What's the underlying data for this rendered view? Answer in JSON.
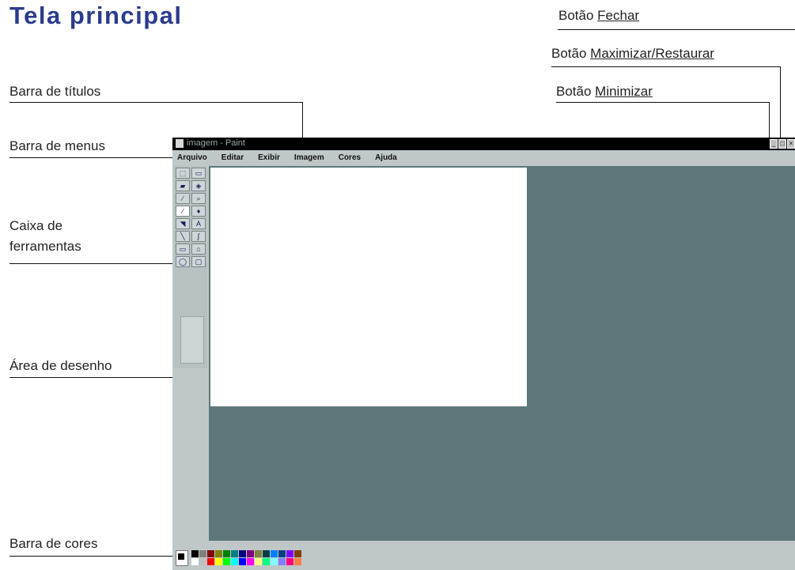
{
  "heading": "Tela principal",
  "callouts": {
    "fechar": {
      "prefix": "Botão ",
      "link": "Fechar"
    },
    "maximizar": {
      "prefix": "Botão ",
      "link": "Maximizar/Restaurar"
    },
    "minimizar": {
      "prefix": "Botão ",
      "link": "Minimizar"
    },
    "titulos": "Barra de títulos",
    "menus": "Barra de menus",
    "ferramentas": "Caixa de ferramentas",
    "desenho": "Área de desenho",
    "cores": "Barra de cores"
  },
  "window": {
    "title": "imagem - Paint",
    "menu": [
      "Arquivo",
      "Editar",
      "Exibir",
      "Imagem",
      "Cores",
      "Ajuda"
    ]
  },
  "tools": [
    {
      "icon": "free-select-icon",
      "glyph": "⬚"
    },
    {
      "icon": "rect-select-icon",
      "glyph": "▭"
    },
    {
      "icon": "eraser-icon",
      "glyph": "▰"
    },
    {
      "icon": "fill-icon",
      "glyph": "◈"
    },
    {
      "icon": "pick-color-icon",
      "glyph": "∕"
    },
    {
      "icon": "magnifier-icon",
      "glyph": "⌕"
    },
    {
      "icon": "pencil-icon",
      "glyph": "∕"
    },
    {
      "icon": "brush-icon",
      "glyph": "♦"
    },
    {
      "icon": "airbrush-icon",
      "glyph": "◥"
    },
    {
      "icon": "text-icon",
      "glyph": "A"
    },
    {
      "icon": "line-icon",
      "glyph": "╲"
    },
    {
      "icon": "curve-icon",
      "glyph": "∫"
    },
    {
      "icon": "rectangle-icon",
      "glyph": "▭"
    },
    {
      "icon": "polygon-icon",
      "glyph": "⌂"
    },
    {
      "icon": "ellipse-icon",
      "glyph": "◯"
    },
    {
      "icon": "rounded-rect-icon",
      "glyph": "▢"
    }
  ],
  "palette": {
    "row1": [
      "#000000",
      "#808080",
      "#800000",
      "#808000",
      "#008000",
      "#008080",
      "#000080",
      "#800080",
      "#808040",
      "#004040",
      "#0080ff",
      "#004080",
      "#8000ff",
      "#804000"
    ],
    "row2": [
      "#ffffff",
      "#c0c0c0",
      "#ff0000",
      "#ffff00",
      "#00ff00",
      "#00ffff",
      "#0000ff",
      "#ff00ff",
      "#ffff80",
      "#00ff80",
      "#80ffff",
      "#8080ff",
      "#ff0080",
      "#ff8040"
    ]
  },
  "colors": {
    "heading": "#2b3b8e",
    "workspace": "#5e7879",
    "window_bg": "#c0c7c8",
    "titlebar": "#000000"
  }
}
